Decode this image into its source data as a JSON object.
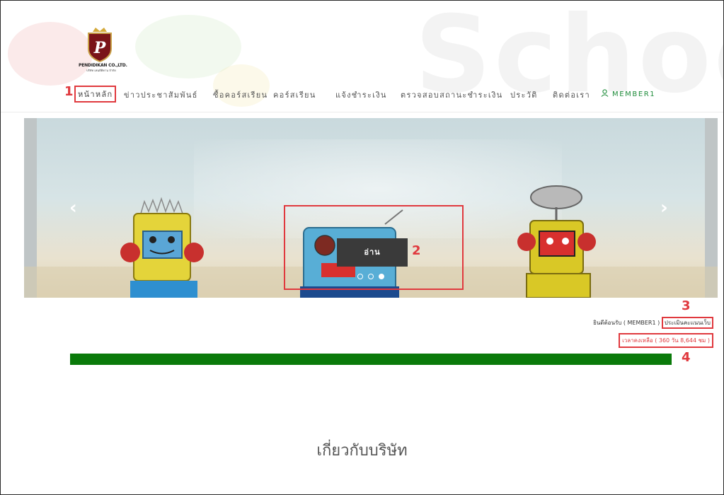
{
  "header": {
    "watermark": "School",
    "logo": {
      "name": "PENDIDIKAN CO.,LTD.",
      "sub": "บริษัท เพนดิดิคาน จำกัด"
    }
  },
  "nav": {
    "items": [
      "หน้าหลัก",
      "ข่าวประชาสัมพันธ์",
      "ซื้อคอร์สเรียน",
      "คอร์สเรียน",
      "แจ้งชำระเงิน",
      "ตรวจสอบสถานะชำระเงิน",
      "ประวัติ",
      "ติดต่อเรา"
    ],
    "user": "MEMBER1"
  },
  "slider": {
    "read_label": "อ่าน",
    "prev": "‹",
    "next": "›",
    "slide_count": 3,
    "active_slide": 3
  },
  "markers": [
    "1",
    "2",
    "3",
    "4"
  ],
  "welcome": {
    "text": "ยินดีต้อนรับ ( MEMBER1 )",
    "eval_link": "ประเมินคะแนนเว็บ"
  },
  "remaining": {
    "text": "เวลาคงเหลือ ( 360 วัน 8,644 ชม )"
  },
  "progress": {
    "fraction": 1.0,
    "color": "#0a7a0a"
  },
  "about": {
    "title": "เกี่ยวกับบริษัท"
  },
  "colors": {
    "accent_red": "#e0393e",
    "user_green": "#1f8c3b"
  }
}
